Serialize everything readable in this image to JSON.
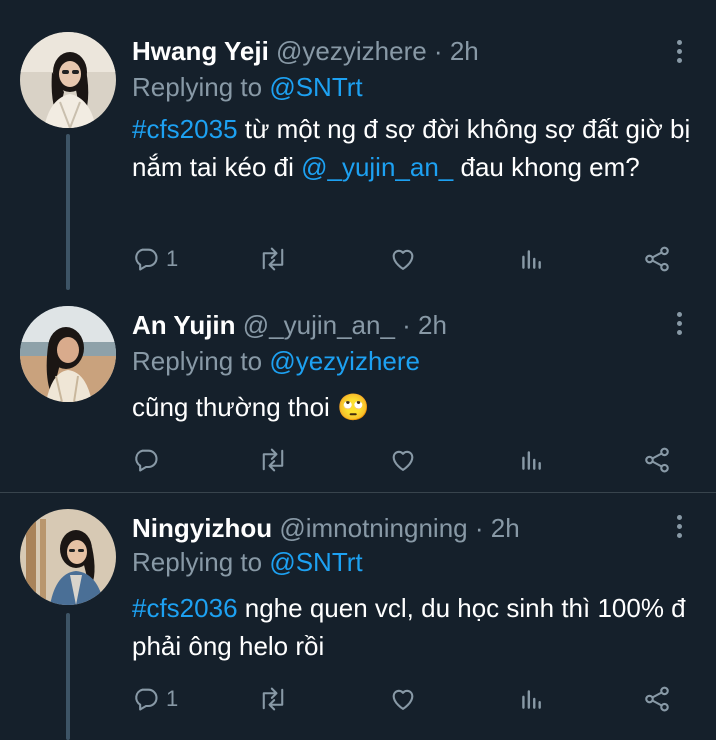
{
  "tweets": [
    {
      "name": "Hwang Yeji",
      "handle": "@yezyizhere",
      "time": "2h",
      "replying_prefix": "Replying to ",
      "replying_to": "@SNTrt",
      "hashtag": "#cfs2035",
      "text_1": " từ một ng đ sợ đời không sợ đất giờ bị nắm tai kéo đi ",
      "mention": "@_yujin_an_",
      "text_2": " đau khong em?",
      "reply_count": "1",
      "avatar": "avatar-yeji"
    },
    {
      "name": "An Yujin",
      "handle": "@_yujin_an_",
      "time": "2h",
      "replying_prefix": "Replying to ",
      "replying_to": "@yezyizhere",
      "text": "cũng thường thoi ",
      "emoji": "🙄",
      "reply_count": "",
      "avatar": "avatar-yujin"
    },
    {
      "name": "Ningyizhou",
      "handle": "@imnotningning",
      "time": "2h",
      "replying_prefix": "Replying to ",
      "replying_to": "@SNTrt",
      "hashtag": "#cfs2036",
      "text_1": " nghe quen vcl, du học sinh thì 100% đ phải ông helo rồi",
      "reply_count": "1",
      "avatar": "avatar-ningning"
    }
  ],
  "separator": " · ",
  "colors": {
    "background": "#15202b",
    "text": "#ffffff",
    "muted": "#8899a6",
    "link": "#1da1f2",
    "divider": "#38444d"
  },
  "icons": [
    "reply-icon",
    "retweet-icon",
    "like-icon",
    "analytics-icon",
    "share-icon",
    "more-options-icon"
  ]
}
